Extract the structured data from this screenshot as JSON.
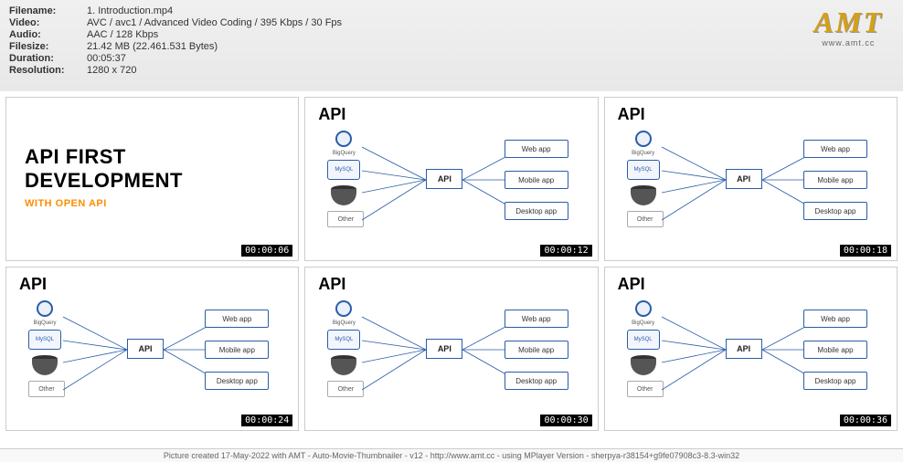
{
  "meta": {
    "filename_label": "Filename:",
    "filename": "1. Introduction.mp4",
    "video_label": "Video:",
    "video": "AVC / avc1 / Advanced Video Coding / 395 Kbps / 30 Fps",
    "audio_label": "Audio:",
    "audio": "AAC / 128 Kbps",
    "filesize_label": "Filesize:",
    "filesize": "21.42 MB (22.461.531 Bytes)",
    "duration_label": "Duration:",
    "duration": "00:05:37",
    "resolution_label": "Resolution:",
    "resolution": "1280 x 720"
  },
  "logo": {
    "main": "AMT",
    "sub": "www.amt.cc"
  },
  "title_thumb": {
    "heading": "API FIRST DEVELOPMENT",
    "sub": "WITH OPEN API"
  },
  "diagram": {
    "api_label": "API",
    "center": "API",
    "src_bigquery": "BigQuery",
    "src_mysql": "MySQL",
    "other": "Other",
    "out_web": "Web app",
    "out_mobile": "Mobile app",
    "out_desktop": "Desktop app"
  },
  "timestamps": [
    "00:00:06",
    "00:00:12",
    "00:00:18",
    "00:00:24",
    "00:00:30",
    "00:00:36"
  ],
  "footer": "Picture created 17-May-2022 with AMT - Auto-Movie-Thumbnailer - v12 - http://www.amt.cc - using MPlayer Version - sherpya-r38154+g9fe07908c3-8.3-win32"
}
